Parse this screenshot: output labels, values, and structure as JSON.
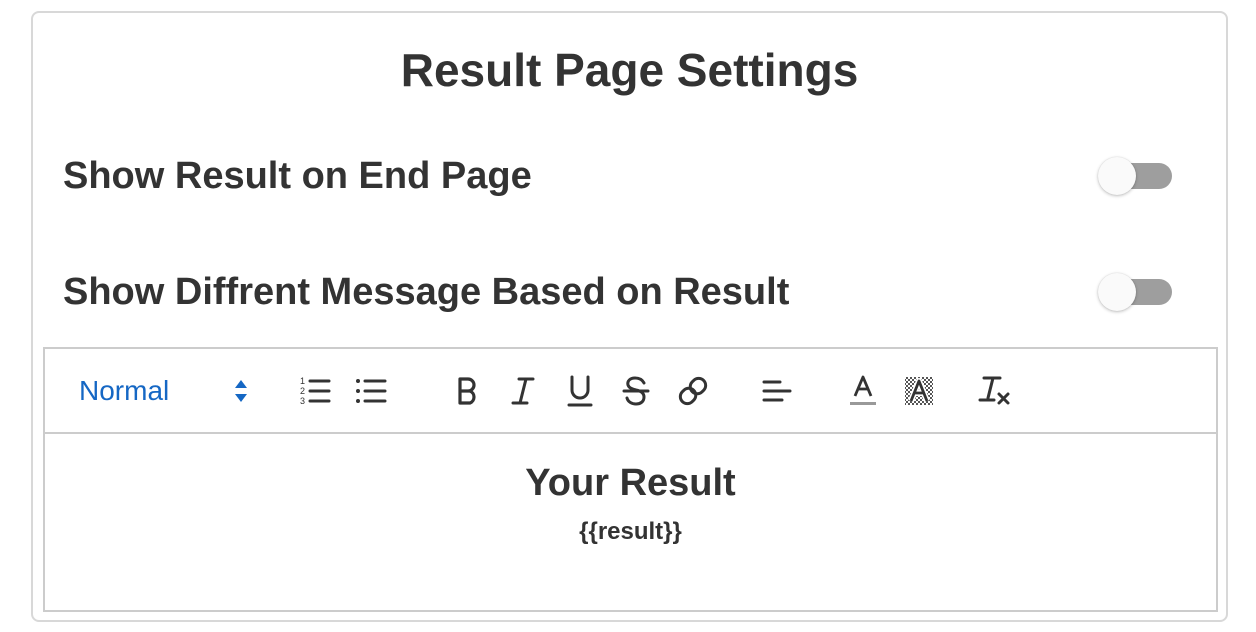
{
  "card": {
    "title": "Result Page Settings"
  },
  "settings": [
    {
      "label": "Show Result on End Page",
      "enabled": false
    },
    {
      "label": "Show Diffrent Message Based on Result",
      "enabled": false
    }
  ],
  "editor": {
    "toolbar": {
      "header_select": "Normal",
      "buttons": [
        "ordered-list-icon",
        "bullet-list-icon",
        "bold-icon",
        "italic-icon",
        "underline-icon",
        "strikethrough-icon",
        "link-icon",
        "align-left-icon",
        "text-color-icon",
        "background-color-icon",
        "clear-format-icon"
      ]
    },
    "content": {
      "heading": "Your Result",
      "placeholder": "{{result}}"
    }
  },
  "colors": {
    "accent": "#1567c4",
    "toggle_off_track": "#9e9e9e",
    "text": "#333333",
    "border": "#d8d8d8"
  }
}
